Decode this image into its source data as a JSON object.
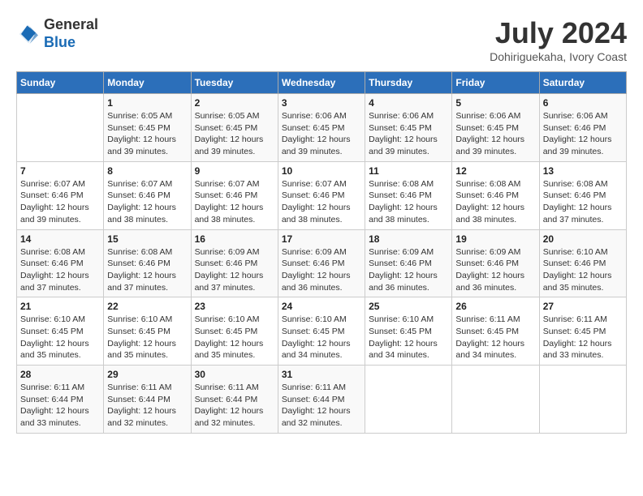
{
  "header": {
    "logo_line1": "General",
    "logo_line2": "Blue",
    "month_year": "July 2024",
    "location": "Dohiriguekaha, Ivory Coast"
  },
  "weekdays": [
    "Sunday",
    "Monday",
    "Tuesday",
    "Wednesday",
    "Thursday",
    "Friday",
    "Saturday"
  ],
  "weeks": [
    [
      {
        "day": "",
        "info": ""
      },
      {
        "day": "1",
        "info": "Sunrise: 6:05 AM\nSunset: 6:45 PM\nDaylight: 12 hours\nand 39 minutes."
      },
      {
        "day": "2",
        "info": "Sunrise: 6:05 AM\nSunset: 6:45 PM\nDaylight: 12 hours\nand 39 minutes."
      },
      {
        "day": "3",
        "info": "Sunrise: 6:06 AM\nSunset: 6:45 PM\nDaylight: 12 hours\nand 39 minutes."
      },
      {
        "day": "4",
        "info": "Sunrise: 6:06 AM\nSunset: 6:45 PM\nDaylight: 12 hours\nand 39 minutes."
      },
      {
        "day": "5",
        "info": "Sunrise: 6:06 AM\nSunset: 6:45 PM\nDaylight: 12 hours\nand 39 minutes."
      },
      {
        "day": "6",
        "info": "Sunrise: 6:06 AM\nSunset: 6:46 PM\nDaylight: 12 hours\nand 39 minutes."
      }
    ],
    [
      {
        "day": "7",
        "info": "Sunrise: 6:07 AM\nSunset: 6:46 PM\nDaylight: 12 hours\nand 39 minutes."
      },
      {
        "day": "8",
        "info": "Sunrise: 6:07 AM\nSunset: 6:46 PM\nDaylight: 12 hours\nand 38 minutes."
      },
      {
        "day": "9",
        "info": "Sunrise: 6:07 AM\nSunset: 6:46 PM\nDaylight: 12 hours\nand 38 minutes."
      },
      {
        "day": "10",
        "info": "Sunrise: 6:07 AM\nSunset: 6:46 PM\nDaylight: 12 hours\nand 38 minutes."
      },
      {
        "day": "11",
        "info": "Sunrise: 6:08 AM\nSunset: 6:46 PM\nDaylight: 12 hours\nand 38 minutes."
      },
      {
        "day": "12",
        "info": "Sunrise: 6:08 AM\nSunset: 6:46 PM\nDaylight: 12 hours\nand 38 minutes."
      },
      {
        "day": "13",
        "info": "Sunrise: 6:08 AM\nSunset: 6:46 PM\nDaylight: 12 hours\nand 37 minutes."
      }
    ],
    [
      {
        "day": "14",
        "info": "Sunrise: 6:08 AM\nSunset: 6:46 PM\nDaylight: 12 hours\nand 37 minutes."
      },
      {
        "day": "15",
        "info": "Sunrise: 6:08 AM\nSunset: 6:46 PM\nDaylight: 12 hours\nand 37 minutes."
      },
      {
        "day": "16",
        "info": "Sunrise: 6:09 AM\nSunset: 6:46 PM\nDaylight: 12 hours\nand 37 minutes."
      },
      {
        "day": "17",
        "info": "Sunrise: 6:09 AM\nSunset: 6:46 PM\nDaylight: 12 hours\nand 36 minutes."
      },
      {
        "day": "18",
        "info": "Sunrise: 6:09 AM\nSunset: 6:46 PM\nDaylight: 12 hours\nand 36 minutes."
      },
      {
        "day": "19",
        "info": "Sunrise: 6:09 AM\nSunset: 6:46 PM\nDaylight: 12 hours\nand 36 minutes."
      },
      {
        "day": "20",
        "info": "Sunrise: 6:10 AM\nSunset: 6:46 PM\nDaylight: 12 hours\nand 35 minutes."
      }
    ],
    [
      {
        "day": "21",
        "info": "Sunrise: 6:10 AM\nSunset: 6:45 PM\nDaylight: 12 hours\nand 35 minutes."
      },
      {
        "day": "22",
        "info": "Sunrise: 6:10 AM\nSunset: 6:45 PM\nDaylight: 12 hours\nand 35 minutes."
      },
      {
        "day": "23",
        "info": "Sunrise: 6:10 AM\nSunset: 6:45 PM\nDaylight: 12 hours\nand 35 minutes."
      },
      {
        "day": "24",
        "info": "Sunrise: 6:10 AM\nSunset: 6:45 PM\nDaylight: 12 hours\nand 34 minutes."
      },
      {
        "day": "25",
        "info": "Sunrise: 6:10 AM\nSunset: 6:45 PM\nDaylight: 12 hours\nand 34 minutes."
      },
      {
        "day": "26",
        "info": "Sunrise: 6:11 AM\nSunset: 6:45 PM\nDaylight: 12 hours\nand 34 minutes."
      },
      {
        "day": "27",
        "info": "Sunrise: 6:11 AM\nSunset: 6:45 PM\nDaylight: 12 hours\nand 33 minutes."
      }
    ],
    [
      {
        "day": "28",
        "info": "Sunrise: 6:11 AM\nSunset: 6:44 PM\nDaylight: 12 hours\nand 33 minutes."
      },
      {
        "day": "29",
        "info": "Sunrise: 6:11 AM\nSunset: 6:44 PM\nDaylight: 12 hours\nand 32 minutes."
      },
      {
        "day": "30",
        "info": "Sunrise: 6:11 AM\nSunset: 6:44 PM\nDaylight: 12 hours\nand 32 minutes."
      },
      {
        "day": "31",
        "info": "Sunrise: 6:11 AM\nSunset: 6:44 PM\nDaylight: 12 hours\nand 32 minutes."
      },
      {
        "day": "",
        "info": ""
      },
      {
        "day": "",
        "info": ""
      },
      {
        "day": "",
        "info": ""
      }
    ]
  ]
}
